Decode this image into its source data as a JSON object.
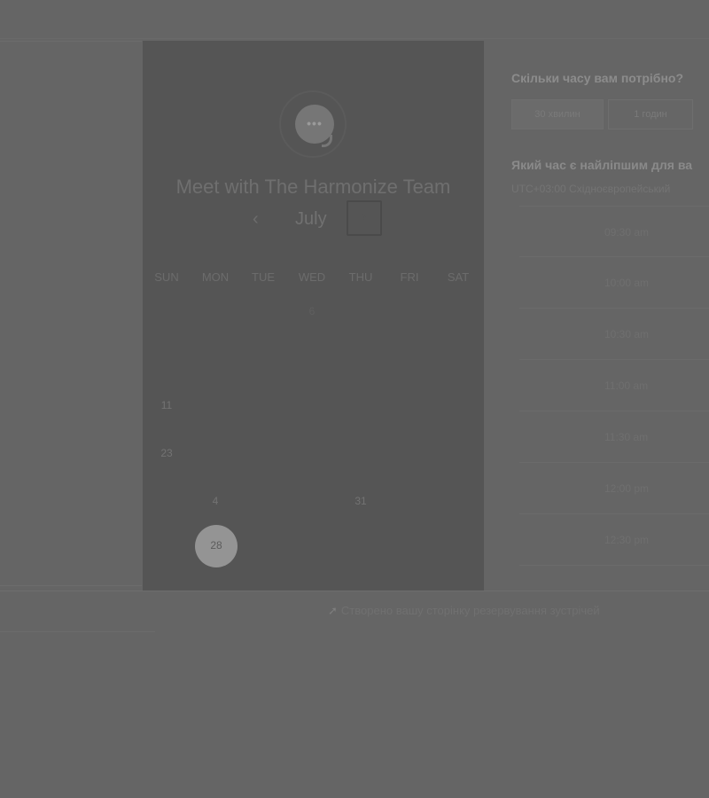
{
  "calendar": {
    "logo_icon": "chat-bubble-icon",
    "title": "Meet with The Harmonize Team",
    "month": "July",
    "prev_icon": "‹",
    "next_icon": "›",
    "weekdays": [
      "SUN",
      "MON",
      "TUE",
      "WED",
      "THU",
      "FRI",
      "SAT"
    ],
    "days": {
      "d6": "6",
      "d11": "11",
      "d23": "23",
      "d24": "4",
      "d27": "31",
      "selected": "28"
    }
  },
  "right": {
    "duration_title": "Скільки часу вам потрібно?",
    "duration_options": [
      "30 хвилин",
      "1 годин"
    ],
    "time_title": "Який час є найліпшим для ва",
    "timezone": "UTC+03:00 Східноєвропейський",
    "slots": [
      "09:30 am",
      "10:00 am",
      "10:30 am",
      "11:00 am",
      "11:30 am",
      "12:00 pm",
      "12:30 pm"
    ]
  },
  "footer": {
    "link_text": "Створено вашу сторінку резервування зустрічей"
  }
}
